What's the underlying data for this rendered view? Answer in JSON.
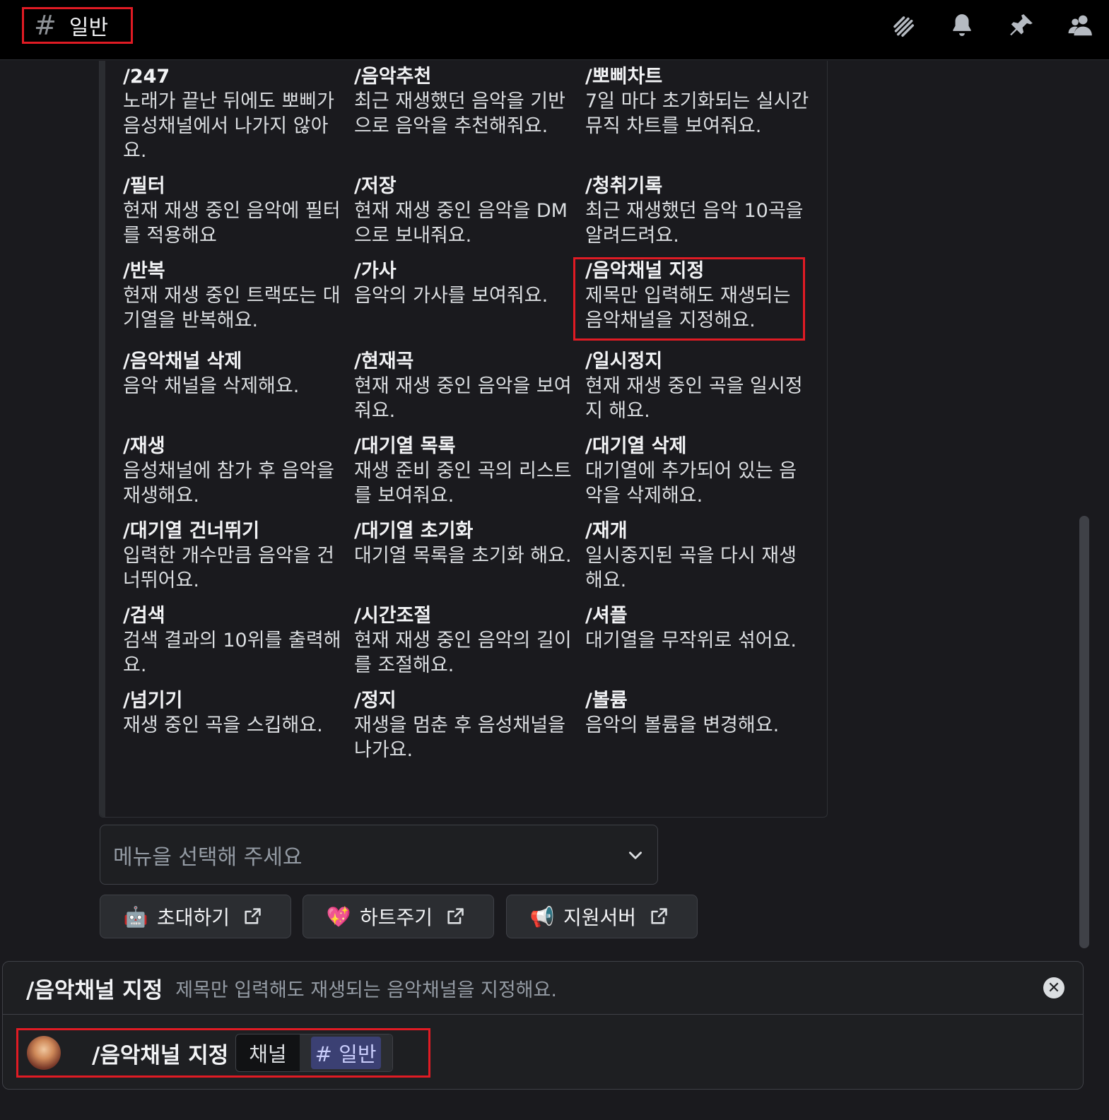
{
  "header": {
    "channel_hash": "#",
    "channel_name": "일반",
    "icons": [
      "threads-icon",
      "bell-icon",
      "pin-icon",
      "members-icon"
    ]
  },
  "commands": [
    {
      "title": "/247",
      "desc": "노래가 끝난 뒤에도 뽀삐가 음성채널에서 나가지 않아요."
    },
    {
      "title": "/음악추천",
      "desc": "최근 재생했던 음악을 기반으로 음악을 추천해줘요."
    },
    {
      "title": "/뽀삐차트",
      "desc": "7일 마다 초기화되는 실시간 뮤직 차트를 보여줘요."
    },
    {
      "title": "/필터",
      "desc": "현재 재생 중인 음악에 필터를 적용해요"
    },
    {
      "title": "/저장",
      "desc": "현재 재생 중인 음악을 DM으로 보내줘요."
    },
    {
      "title": "/청취기록",
      "desc": "최근 재생했던 음악 10곡을 알려드려요."
    },
    {
      "title": "/반복",
      "desc": "현재 재생 중인 트랙또는 대기열을 반복해요."
    },
    {
      "title": "/가사",
      "desc": "음악의 가사를 보여줘요."
    },
    {
      "title": "/음악채널 지정",
      "desc": "제목만 입력해도 재생되는 음악채널을 지정해요."
    },
    {
      "title": "/음악채널 삭제",
      "desc": "음악 채널을 삭제해요."
    },
    {
      "title": "/현재곡",
      "desc": "현재 재생 중인 음악을 보여줘요."
    },
    {
      "title": "/일시정지",
      "desc": "현재 재생 중인 곡을 일시정지 해요."
    },
    {
      "title": "/재생",
      "desc": "음성채널에 참가 후 음악을 재생해요."
    },
    {
      "title": "/대기열 목록",
      "desc": "재생 준비 중인 곡의 리스트를 보여줘요."
    },
    {
      "title": "/대기열 삭제",
      "desc": "대기열에 추가되어 있는 음악을 삭제해요."
    },
    {
      "title": "/대기열 건너뛰기",
      "desc": "입력한 개수만큼 음악을 건너뛰어요."
    },
    {
      "title": "/대기열 초기화",
      "desc": "대기열 목록을 초기화 해요."
    },
    {
      "title": "/재개",
      "desc": "일시중지된 곡을 다시 재생해요."
    },
    {
      "title": "/검색",
      "desc": "검색 결과의 10위를 출력해요."
    },
    {
      "title": "/시간조절",
      "desc": "현재 재생 중인 음악의 길이를 조절해요."
    },
    {
      "title": "/셔플",
      "desc": "대기열을 무작위로 섞어요."
    },
    {
      "title": "/넘기기",
      "desc": "재생 중인 곡을 스킵해요."
    },
    {
      "title": "/정지",
      "desc": "재생을 멈춘 후 음성채널을 나가요."
    },
    {
      "title": "/볼륨",
      "desc": "음악의 볼륨을 변경해요."
    }
  ],
  "select": {
    "placeholder": "메뉴을 선택해 주세요"
  },
  "buttons": [
    {
      "emoji": "🤖",
      "label": "초대하기"
    },
    {
      "emoji": "💖",
      "label": "하트주기"
    },
    {
      "emoji": "📢",
      "label": "지원서버"
    }
  ],
  "slash_panel": {
    "command": "/음악채널 지정",
    "description": "제목만 입력해도 재생되는 음악채널을 지정해요.",
    "close_symbol": "✕"
  },
  "composer": {
    "command": "/음악채널 지정",
    "option_name": "채널",
    "option_hash": "#",
    "option_value": "일반"
  }
}
